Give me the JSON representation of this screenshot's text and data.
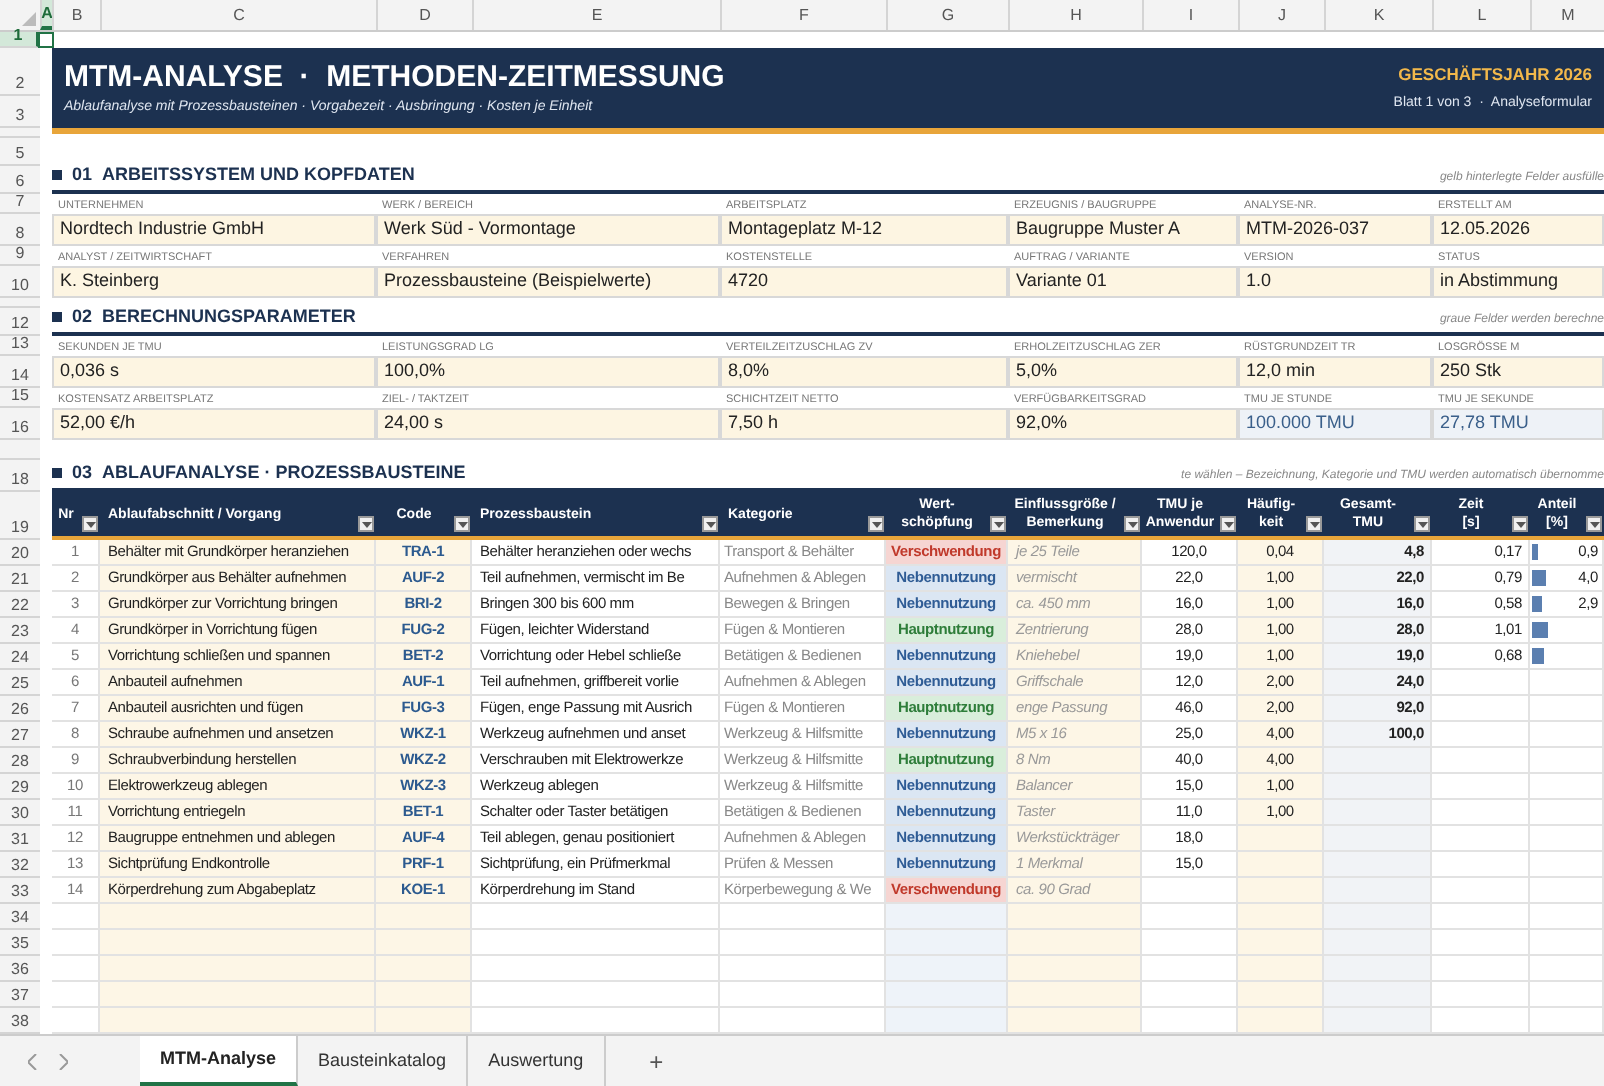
{
  "column_headers": [
    {
      "label": "A",
      "selected": true
    },
    {
      "label": "B",
      "selected": false
    },
    {
      "label": "C",
      "selected": false
    },
    {
      "label": "D",
      "selected": false
    },
    {
      "label": "E",
      "selected": false
    },
    {
      "label": "F",
      "selected": false
    },
    {
      "label": "G",
      "selected": false
    },
    {
      "label": "H",
      "selected": false
    },
    {
      "label": "I",
      "selected": false
    },
    {
      "label": "J",
      "selected": false
    },
    {
      "label": "K",
      "selected": false
    },
    {
      "label": "L",
      "selected": false
    },
    {
      "label": "M",
      "selected": false
    }
  ],
  "row_headers": [
    {
      "label": "1",
      "selected": true
    },
    {
      "label": "2",
      "selected": false
    },
    {
      "label": "3",
      "selected": false
    },
    {
      "label": "5",
      "selected": false
    },
    {
      "label": "6",
      "selected": false
    },
    {
      "label": "7",
      "selected": false
    },
    {
      "label": "8",
      "selected": false
    },
    {
      "label": "9",
      "selected": false
    },
    {
      "label": "10",
      "selected": false
    },
    {
      "label": "12",
      "selected": false
    },
    {
      "label": "13",
      "selected": false
    },
    {
      "label": "14",
      "selected": false
    },
    {
      "label": "15",
      "selected": false
    },
    {
      "label": "16",
      "selected": false
    },
    {
      "label": "18",
      "selected": false
    },
    {
      "label": "19",
      "selected": false
    },
    {
      "label": "20",
      "selected": false
    },
    {
      "label": "21",
      "selected": false
    },
    {
      "label": "22",
      "selected": false
    },
    {
      "label": "23",
      "selected": false
    },
    {
      "label": "24",
      "selected": false
    },
    {
      "label": "25",
      "selected": false
    },
    {
      "label": "26",
      "selected": false
    },
    {
      "label": "27",
      "selected": false
    },
    {
      "label": "28",
      "selected": false
    },
    {
      "label": "29",
      "selected": false
    },
    {
      "label": "30",
      "selected": false
    },
    {
      "label": "31",
      "selected": false
    },
    {
      "label": "32",
      "selected": false
    },
    {
      "label": "33",
      "selected": false
    },
    {
      "label": "34",
      "selected": false
    },
    {
      "label": "35",
      "selected": false
    },
    {
      "label": "36",
      "selected": false
    },
    {
      "label": "37",
      "selected": false
    },
    {
      "label": "38",
      "selected": false
    }
  ],
  "banner": {
    "title": "MTM-ANALYSE  ·  METHODEN-ZEITMESSUNG",
    "subtitle": "Ablaufanalyse mit Prozessbausteinen · Vorgabezeit · Ausbringung · Kosten je Einheit",
    "fiscal_year": "GESCHÄFTSJAHR 2026",
    "sheet_info": "Blatt 1 von 3  ·  Analyseformular"
  },
  "sections": [
    {
      "number": "01",
      "title": "ARBEITSSYSTEM UND KOPFDATEN",
      "hint": "gelb hinterlegte Felder ausfülle",
      "field_rows": [
        [
          {
            "label": "UNTERNEHMEN",
            "value": "Nordtech Industrie GmbH",
            "computed": false
          },
          {
            "label": "WERK / BEREICH",
            "value": "Werk Süd - Vormontage",
            "computed": false
          },
          {
            "label": "ARBEITSPLATZ",
            "value": "Montageplatz M-12",
            "computed": false
          },
          {
            "label": "ERZEUGNIS / BAUGRUPPE",
            "value": "Baugruppe Muster A",
            "computed": false
          },
          {
            "label": "ANALYSE-NR.",
            "value": "MTM-2026-037",
            "computed": false
          },
          {
            "label": "ERSTELLT AM",
            "value": "12.05.2026",
            "computed": false
          }
        ],
        [
          {
            "label": "ANALYST / ZEITWIRTSCHAFT",
            "value": "K. Steinberg",
            "computed": false
          },
          {
            "label": "VERFAHREN",
            "value": "Prozessbausteine (Beispielwerte)",
            "computed": false
          },
          {
            "label": "KOSTENSTELLE",
            "value": "4720",
            "computed": false
          },
          {
            "label": "AUFTRAG / VARIANTE",
            "value": "Variante 01",
            "computed": false
          },
          {
            "label": "VERSION",
            "value": "1.0",
            "computed": false
          },
          {
            "label": "STATUS",
            "value": "in Abstimmung",
            "computed": false
          }
        ]
      ]
    },
    {
      "number": "02",
      "title": "BERECHNUNGSPARAMETER",
      "hint": "graue Felder werden berechne",
      "field_rows": [
        [
          {
            "label": "SEKUNDEN JE TMU",
            "value": "0,036 s",
            "computed": false
          },
          {
            "label": "LEISTUNGSGRAD LG",
            "value": "100,0%",
            "computed": false
          },
          {
            "label": "VERTEILZEITZUSCHLAG ZV",
            "value": "8,0%",
            "computed": false
          },
          {
            "label": "ERHOLZEITZUSCHLAG ZER",
            "value": "5,0%",
            "computed": false
          },
          {
            "label": "RÜSTGRUNDZEIT TR",
            "value": "12,0 min",
            "computed": false
          },
          {
            "label": "LOSGRÖSSE M",
            "value": "250 Stk",
            "computed": false
          }
        ],
        [
          {
            "label": "KOSTENSATZ ARBEITSPLATZ",
            "value": "52,00 €/h",
            "computed": false
          },
          {
            "label": "ZIEL- / TAKTZEIT",
            "value": "24,00 s",
            "computed": false
          },
          {
            "label": "SCHICHTZEIT NETTO",
            "value": "7,50 h",
            "computed": false
          },
          {
            "label": "VERFÜGBARKEITSGRAD",
            "value": "92,0%",
            "computed": false
          },
          {
            "label": "TMU JE STUNDE",
            "value": "100.000 TMU",
            "computed": true
          },
          {
            "label": "TMU JE SEKUNDE",
            "value": "27,78 TMU",
            "computed": true
          }
        ]
      ]
    }
  ],
  "analysis": {
    "number": "03",
    "title": "ABLAUFANALYSE · PROZESSBAUSTEINE",
    "hint": "te wählen – Bezeichnung, Kategorie und TMU werden automatisch übernomme",
    "columns": [
      {
        "lines": [
          "Nr"
        ]
      },
      {
        "lines": [
          "Ablaufabschnitt / Vorgang"
        ]
      },
      {
        "lines": [
          "Code"
        ]
      },
      {
        "lines": [
          "Prozessbaustein"
        ]
      },
      {
        "lines": [
          "Kategorie"
        ]
      },
      {
        "lines": [
          "Wert-",
          "schöpfung"
        ]
      },
      {
        "lines": [
          "Einflussgröße /",
          "Bemerkung"
        ]
      },
      {
        "lines": [
          "TMU je",
          "Anwendur"
        ]
      },
      {
        "lines": [
          "Häufig-",
          "keit"
        ]
      },
      {
        "lines": [
          "Gesamt-",
          "TMU"
        ]
      },
      {
        "lines": [
          "Zeit",
          "[s]"
        ]
      },
      {
        "lines": [
          "Anteil",
          "[%]"
        ]
      }
    ],
    "rows": [
      {
        "nr": "1",
        "vorgang": "Behälter mit Grundkörper heranziehen",
        "code": "TRA-1",
        "baustein": "Behälter heranziehen oder wechs",
        "kategorie": "Transport & Behälter",
        "wertschoepfung": {
          "label": "Verschwendung",
          "kind": "waste"
        },
        "einfluss": "je 25 Teile",
        "tmu": "120,0",
        "haeufigkeit": "0,04",
        "gesamt": "4,8",
        "zeit": "0,17",
        "anteil": "0,9",
        "level": 0.1
      },
      {
        "nr": "2",
        "vorgang": "Grundkörper aus Behälter aufnehmen",
        "code": "AUF-2",
        "baustein": "Teil aufnehmen, vermischt im Be",
        "kategorie": "Aufnehmen & Ablegen",
        "wertschoepfung": {
          "label": "Nebennutzung",
          "kind": "secondary"
        },
        "einfluss": "vermischt",
        "tmu": "22,0",
        "haeufigkeit": "1,00",
        "gesamt": "22,0",
        "zeit": "0,79",
        "anteil": "4,0",
        "level": 0.2
      },
      {
        "nr": "3",
        "vorgang": "Grundkörper zur Vorrichtung bringen",
        "code": "BRI-2",
        "baustein": "Bringen 300 bis 600 mm",
        "kategorie": "Bewegen & Bringen",
        "wertschoepfung": {
          "label": "Nebennutzung",
          "kind": "secondary"
        },
        "einfluss": "ca. 450 mm",
        "tmu": "16,0",
        "haeufigkeit": "1,00",
        "gesamt": "16,0",
        "zeit": "0,58",
        "anteil": "2,9",
        "level": 0.16
      },
      {
        "nr": "4",
        "vorgang": "Grundkörper in Vorrichtung fügen",
        "code": "FUG-2",
        "baustein": "Fügen, leichter Widerstand",
        "kategorie": "Fügen & Montieren",
        "wertschoepfung": {
          "label": "Hauptnutzung",
          "kind": "primary"
        },
        "einfluss": "Zentrierung",
        "tmu": "28,0",
        "haeufigkeit": "1,00",
        "gesamt": "28,0",
        "zeit": "1,01",
        "level": 0.24
      },
      {
        "nr": "5",
        "vorgang": "Vorrichtung schließen und spannen",
        "code": "BET-2",
        "baustein": "Vorrichtung oder Hebel schließe",
        "kategorie": "Betätigen & Bedienen",
        "wertschoepfung": {
          "label": "Nebennutzung",
          "kind": "secondary"
        },
        "einfluss": "Kniehebel",
        "tmu": "19,0",
        "haeufigkeit": "1,00",
        "gesamt": "19,0",
        "zeit": "0,68",
        "level": 0.17
      },
      {
        "nr": "6",
        "vorgang": "Anbauteil aufnehmen",
        "code": "AUF-1",
        "baustein": "Teil aufnehmen, griffbereit vorlie",
        "kategorie": "Aufnehmen & Ablegen",
        "wertschoepfung": {
          "label": "Nebennutzung",
          "kind": "secondary"
        },
        "einfluss": "Griffschale",
        "tmu": "12,0",
        "haeufigkeit": "2,00",
        "gesamt": "24,0"
      },
      {
        "nr": "7",
        "vorgang": "Anbauteil ausrichten und fügen",
        "code": "FUG-3",
        "baustein": "Fügen, enge Passung mit Ausrich",
        "kategorie": "Fügen & Montieren",
        "wertschoepfung": {
          "label": "Hauptnutzung",
          "kind": "primary"
        },
        "einfluss": "enge Passung",
        "tmu": "46,0",
        "haeufigkeit": "2,00",
        "gesamt": "92,0"
      },
      {
        "nr": "8",
        "vorgang": "Schraube aufnehmen und ansetzen",
        "code": "WKZ-1",
        "baustein": "Werkzeug aufnehmen und anset",
        "kategorie": "Werkzeug & Hilfsmitte",
        "wertschoepfung": {
          "label": "Nebennutzung",
          "kind": "secondary"
        },
        "einfluss": "M5 x 16",
        "tmu": "25,0",
        "haeufigkeit": "4,00",
        "gesamt": "100,0"
      },
      {
        "nr": "9",
        "vorgang": "Schraubverbindung herstellen",
        "code": "WKZ-2",
        "baustein": "Verschrauben mit Elektrowerkze",
        "kategorie": "Werkzeug & Hilfsmitte",
        "wertschoepfung": {
          "label": "Hauptnutzung",
          "kind": "primary"
        },
        "einfluss": "8 Nm",
        "tmu": "40,0",
        "haeufigkeit": "4,00"
      },
      {
        "nr": "10",
        "vorgang": "Elektrowerkzeug ablegen",
        "code": "WKZ-3",
        "baustein": "Werkzeug ablegen",
        "kategorie": "Werkzeug & Hilfsmitte",
        "wertschoepfung": {
          "label": "Nebennutzung",
          "kind": "secondary"
        },
        "einfluss": "Balancer",
        "tmu": "15,0",
        "haeufigkeit": "1,00"
      },
      {
        "nr": "11",
        "vorgang": "Vorrichtung entriegeln",
        "code": "BET-1",
        "baustein": "Schalter oder Taster betätigen",
        "kategorie": "Betätigen & Bedienen",
        "wertschoepfung": {
          "label": "Nebennutzung",
          "kind": "secondary"
        },
        "einfluss": "Taster",
        "tmu": "11,0",
        "haeufigkeit": "1,00"
      },
      {
        "nr": "12",
        "vorgang": "Baugruppe entnehmen und ablegen",
        "code": "AUF-4",
        "baustein": "Teil ablegen, genau positioniert",
        "kategorie": "Aufnehmen & Ablegen",
        "wertschoepfung": {
          "label": "Nebennutzung",
          "kind": "secondary"
        },
        "einfluss": "Werkstückträger",
        "tmu": "18,0"
      },
      {
        "nr": "13",
        "vorgang": "Sichtprüfung Endkontrolle",
        "code": "PRF-1",
        "baustein": "Sichtprüfung, ein Prüfmerkmal",
        "kategorie": "Prüfen & Messen",
        "wertschoepfung": {
          "label": "Nebennutzung",
          "kind": "secondary"
        },
        "einfluss": "1 Merkmal",
        "tmu": "15,0"
      },
      {
        "nr": "14",
        "vorgang": "Körperdrehung zum Abgabeplatz",
        "code": "KOE-1",
        "baustein": "Körperdrehung im Stand",
        "kategorie": "Körperbewegung & We",
        "wertschoepfung": {
          "label": "Verschwendung",
          "kind": "waste"
        },
        "einfluss": "ca. 90 Grad"
      }
    ]
  },
  "sheet_tabs": [
    {
      "label": "MTM-Analyse",
      "selected": true
    },
    {
      "label": "Bausteinkatalog",
      "selected": false
    },
    {
      "label": "Auswertung",
      "selected": false
    }
  ],
  "add_sheet": "+"
}
